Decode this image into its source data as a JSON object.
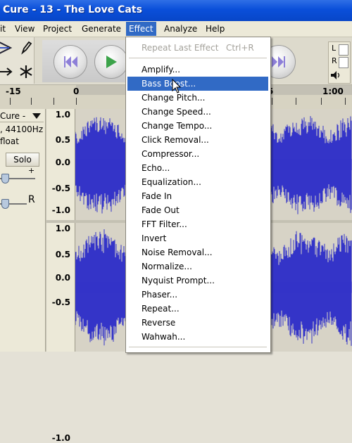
{
  "window": {
    "title": "Cure - 13 - The Love Cats"
  },
  "menubar": {
    "items": [
      "it",
      "View",
      "Project",
      "Generate",
      "Effect",
      "Analyze",
      "Help"
    ],
    "active": "Effect"
  },
  "effect_menu": {
    "repeat_last": {
      "label": "Repeat Last Effect",
      "shortcut": "Ctrl+R"
    },
    "items": [
      "Amplify...",
      "Bass Boost...",
      "Change Pitch...",
      "Change Speed...",
      "Change Tempo...",
      "Click Removal...",
      "Compressor...",
      "Echo...",
      "Equalization...",
      "Fade In",
      "Fade Out",
      "FFT Filter...",
      "Invert",
      "Noise Removal...",
      "Normalize...",
      "Nyquist Prompt...",
      "Phaser...",
      "Repeat...",
      "Reverse",
      "Wahwah..."
    ],
    "highlighted": "Bass Boost..."
  },
  "ruler": {
    "labels": [
      "-15",
      "0",
      "5",
      "1:00"
    ]
  },
  "track": {
    "name": "Cure -",
    "rate": ", 44100Hz",
    "format": "float",
    "solo_label": "Solo",
    "gain_plus": "+",
    "pan_right": "R"
  },
  "amplitude_labels": [
    "1.0",
    "0.5",
    "0.0",
    "-0.5",
    "-1.0"
  ],
  "meter": {
    "l": "L",
    "r": "R"
  },
  "colors": {
    "waveform": "#3434c8",
    "highlight": "#316ac5",
    "titlebar": "#0a4fd9"
  }
}
